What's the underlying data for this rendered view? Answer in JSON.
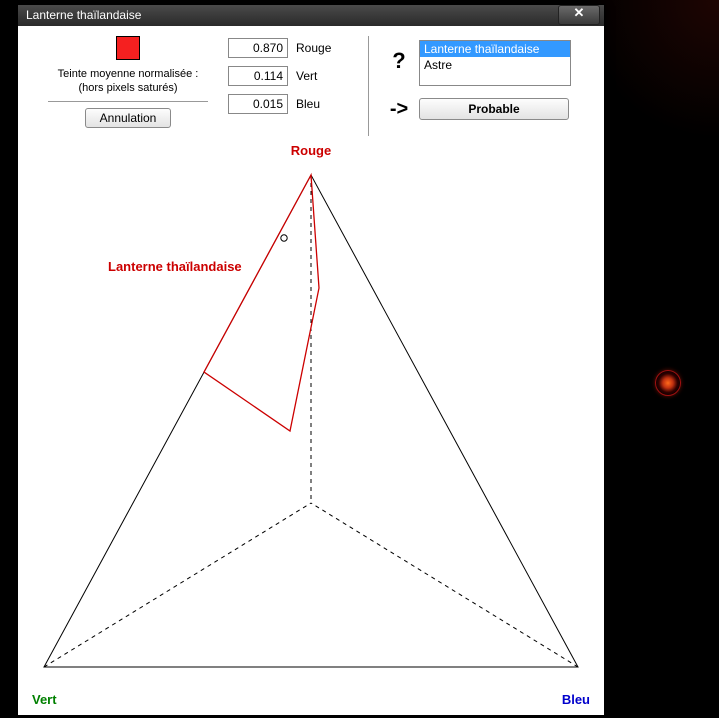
{
  "window": {
    "title": "Lanterne thaïlandaise",
    "close_glyph": "✕"
  },
  "swatch": {
    "color": "#f52020",
    "label_line1": "Teinte moyenne normalisée :",
    "label_line2": "(hors pixels saturés)"
  },
  "buttons": {
    "cancel": "Annulation",
    "probable": "Probable"
  },
  "rgb": {
    "r_value": "0.870",
    "r_label": "Rouge",
    "g_value": "0.114",
    "g_label": "Vert",
    "b_value": "0.015",
    "b_label": "Bleu"
  },
  "right": {
    "question": "?",
    "arrow": "->",
    "list": {
      "item0": "Lanterne thaïlandaise",
      "item1": "Astre"
    }
  },
  "chart": {
    "top_label": "Rouge",
    "left_label": "Vert",
    "right_label": "Bleu",
    "region_label": "Lanterne thaïlandaise",
    "colors": {
      "rouge": "#cc0000",
      "vert": "#008000",
      "bleu": "#0000cc"
    }
  },
  "chart_data": {
    "type": "ternary",
    "axes": {
      "top": "Rouge",
      "left": "Vert",
      "right": "Bleu"
    },
    "point": {
      "r": 0.87,
      "g": 0.114,
      "b": 0.015
    },
    "region": {
      "name": "Lanterne thaïlandaise",
      "vertices_rgb": [
        {
          "r": 1.0,
          "g": 0.0,
          "b": 0.0
        },
        {
          "r": 0.6,
          "g": 0.4,
          "b": 0.0
        },
        {
          "r": 0.48,
          "g": 0.3,
          "b": 0.22
        },
        {
          "r": 0.77,
          "g": 0.1,
          "b": 0.13
        }
      ]
    }
  }
}
